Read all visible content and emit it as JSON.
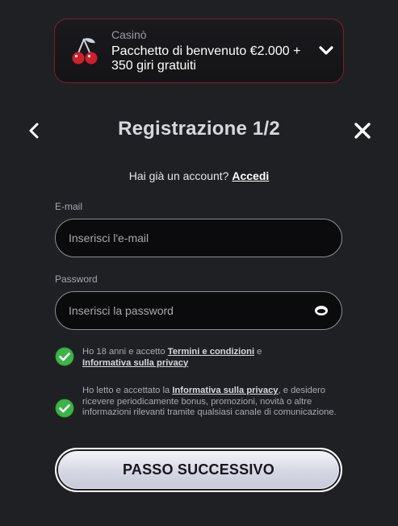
{
  "bonus": {
    "category": "Casinò",
    "title": "Pacchetto di benvenuto €2.000 + 350 giri gratuiti"
  },
  "header": {
    "title": "Registrazione 1/2"
  },
  "login": {
    "prompt": "Hai già un account?",
    "link": "Accedi"
  },
  "form": {
    "email_label": "E-mail",
    "email_placeholder": "Inserisci l'e-mail",
    "password_label": "Password",
    "password_placeholder": "Inserisci la password"
  },
  "consents": [
    {
      "pre": "Ho 18 anni e accetto ",
      "link1": "Termini e condizioni",
      "mid": " e ",
      "link2": "Informativa sulla privacy",
      "checked": true
    },
    {
      "pre": "Ho letto e accettato la ",
      "link1": "Informativa sulla privacy",
      "post": ", e desidero ricevere periodicamente bonus, promozioni, novità o altre informazioni rilevanti tramite qualsiasi canale di comunicazione.",
      "checked": true
    }
  ],
  "submit_label": "PASSO SUCCESSIVO",
  "colors": {
    "background": "#1f2024",
    "accent_border": "#7a2030",
    "check_green": "#2e9a3a"
  },
  "icons": [
    "cherry-icon",
    "chevron-down-icon",
    "back-arrow-icon",
    "close-icon",
    "eye-icon",
    "check-icon"
  ]
}
